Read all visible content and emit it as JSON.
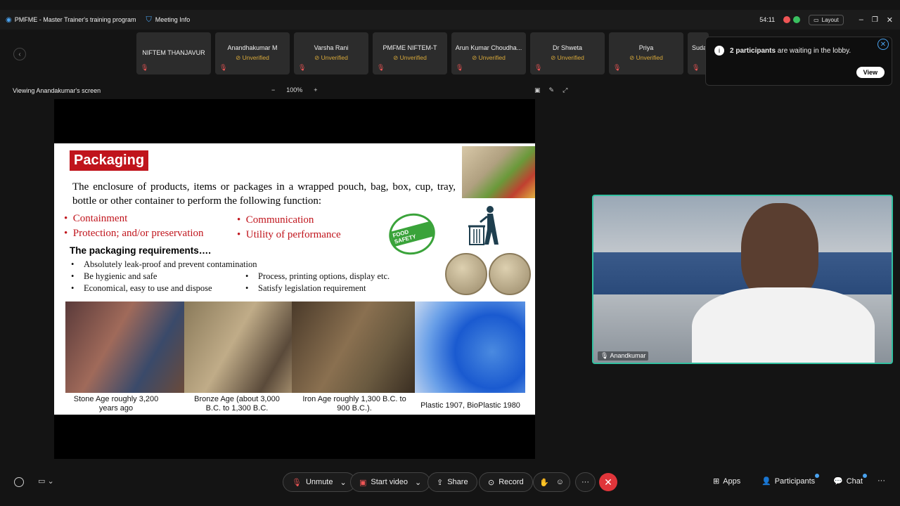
{
  "topbar": {
    "app_title": "PMFME - Master Trainer's training program",
    "meeting_info": "Meeting Info",
    "timer": "54:11",
    "layout_label": "Layout"
  },
  "participants_strip": [
    {
      "name": "NIFTEM THANJAVUR",
      "status": ""
    },
    {
      "name": "Anandhakumar M",
      "status": "Unverified"
    },
    {
      "name": "Varsha Rani",
      "status": "Unverified"
    },
    {
      "name": "PMFME NIFTEM-T",
      "status": "Unverified"
    },
    {
      "name": "Arun Kumar Choudha...",
      "status": "Unverified"
    },
    {
      "name": "Dr Shweta",
      "status": "Unverified"
    },
    {
      "name": "Priya",
      "status": "Unverified"
    },
    {
      "name": "Suda",
      "status": ""
    }
  ],
  "viewing": {
    "label": "Viewing Anandakumar's screen",
    "zoom": "100%",
    "zoom_out": "−",
    "zoom_in": "+"
  },
  "slide": {
    "title": "Packaging",
    "intro": "The enclosure of products, items or packages in a wrapped pouch, bag, box, cup, tray, bottle or  other container to perform the following function:",
    "functions_left": [
      "Containment",
      "Protection; and/or preservation"
    ],
    "functions_right": [
      "Communication",
      "Utility of performance"
    ],
    "requirements_title": "The packaging requirements….",
    "requirements_left": [
      "Absolutely leak-proof and prevent contamination",
      "Be hygienic and safe",
      "Economical, easy to use and dispose"
    ],
    "requirements_right": [
      "Process, printing options, display etc.",
      "Satisfy legislation requirement"
    ],
    "badge_text": "FOOD SAFETY",
    "captions": [
      "Stone Age roughly 3,200 years ago",
      "Bronze Age (about 3,000 B.C. to 1,300 B.C.",
      "Iron Age roughly 1,300 B.C. to 900 B.C.).",
      "Plastic 1907, BioPlastic 1980"
    ]
  },
  "video": {
    "name": "Anandkumar"
  },
  "toast": {
    "count": "2 participants",
    "message": " are waiting in the lobby.",
    "view_label": "View"
  },
  "bottombar": {
    "unmute": "Unmute",
    "start_video": "Start video",
    "share": "Share",
    "record": "Record",
    "more": "···",
    "apps": "Apps",
    "participants": "Participants",
    "chat": "Chat",
    "overflow": "···"
  },
  "colors": {
    "accent_red": "#e0353a",
    "slide_red": "#c0141c",
    "video_border": "#32c0a0",
    "unverified": "#d8a93a"
  }
}
